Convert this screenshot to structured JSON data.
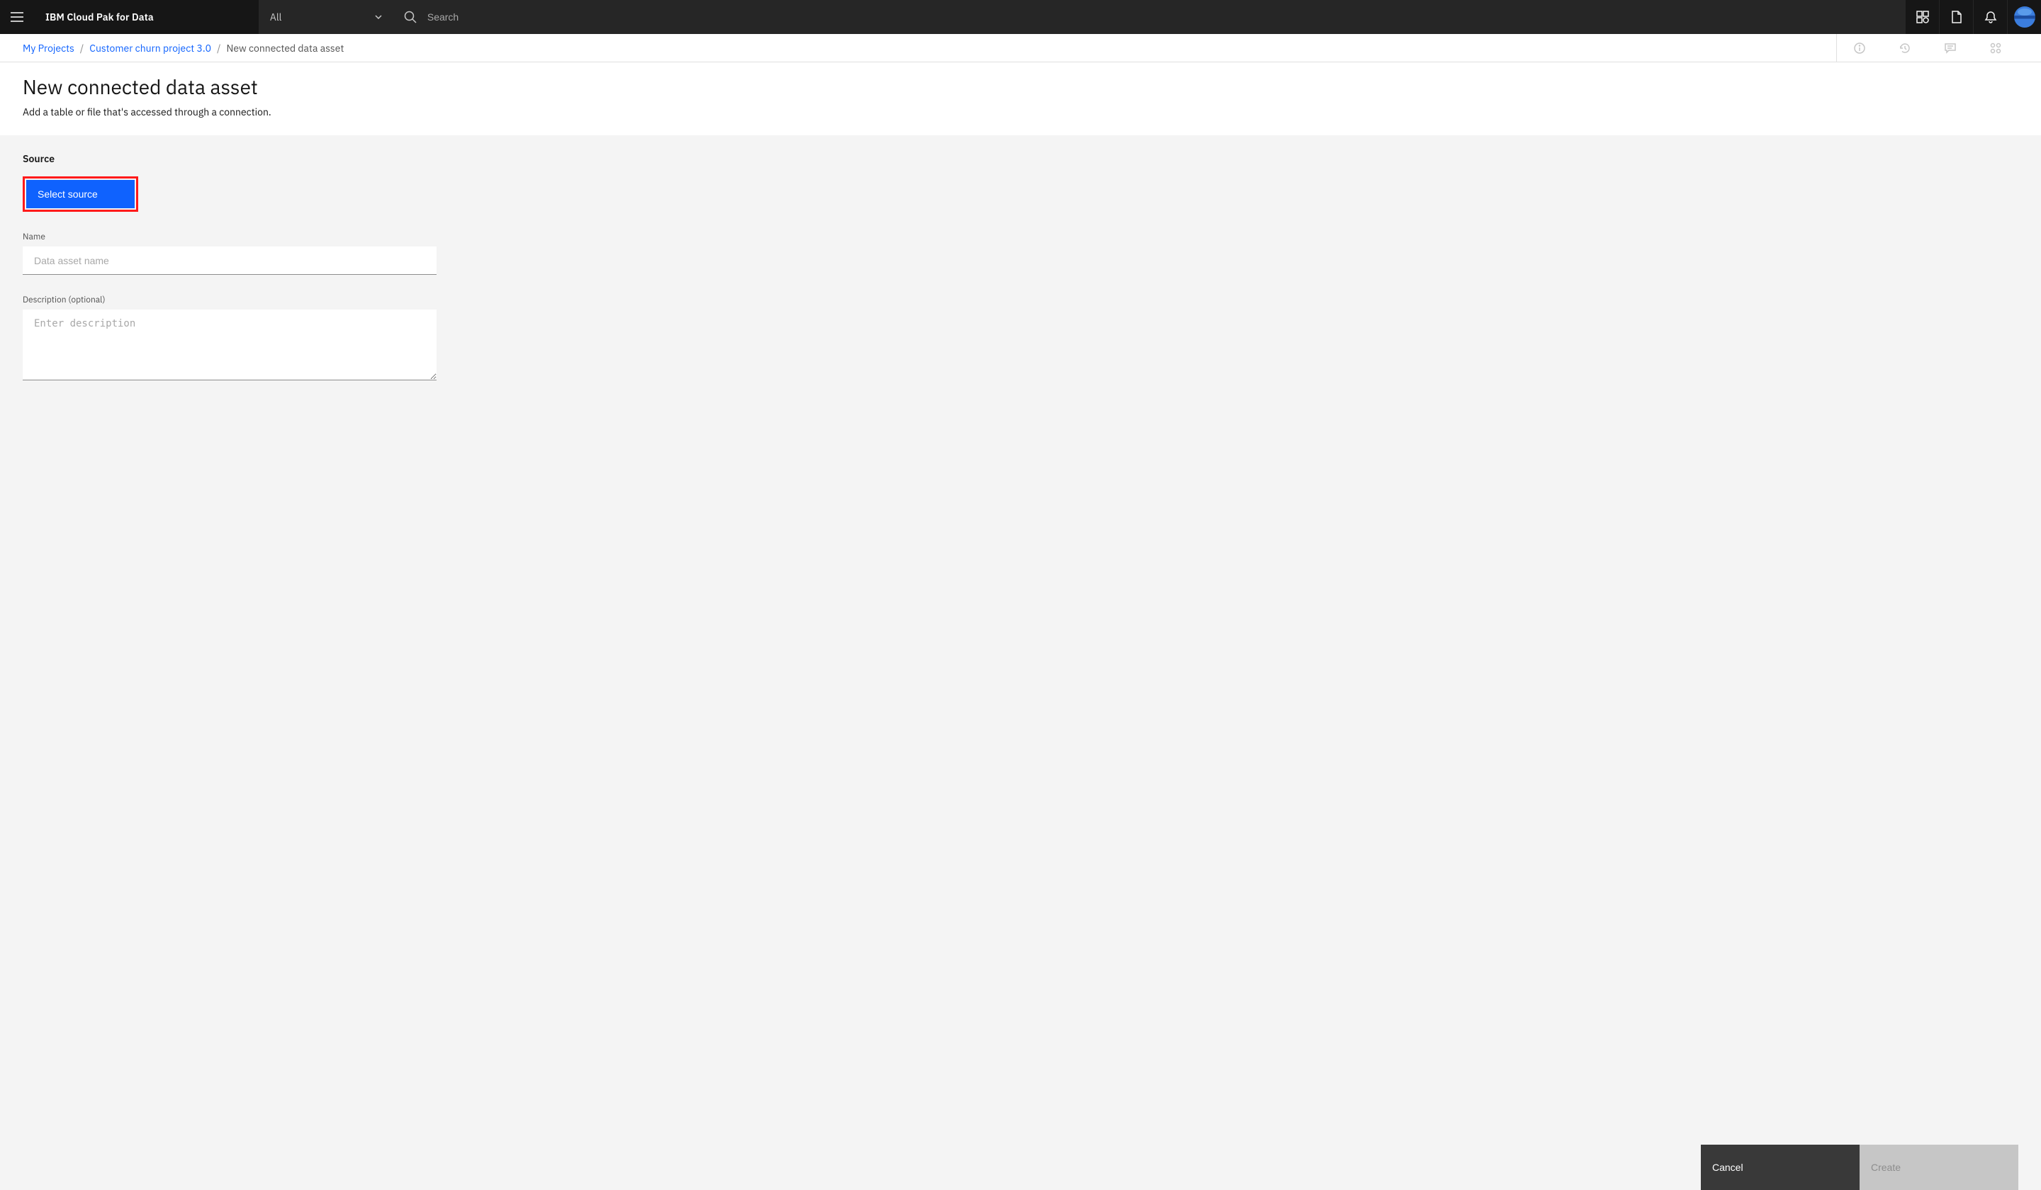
{
  "header": {
    "brand": "IBM Cloud Pak for Data",
    "scope": "All",
    "search_placeholder": "Search"
  },
  "breadcrumb": {
    "root": "My Projects",
    "project": "Customer churn project 3.0",
    "current": "New connected data asset"
  },
  "page": {
    "title": "New connected data asset",
    "subtitle": "Add a table or file that's accessed through a connection."
  },
  "form": {
    "source_label": "Source",
    "select_source_btn": "Select source",
    "name_label": "Name",
    "name_placeholder": "Data asset name",
    "desc_label": "Description (optional)",
    "desc_placeholder": "Enter description"
  },
  "actions": {
    "cancel": "Cancel",
    "create": "Create"
  }
}
